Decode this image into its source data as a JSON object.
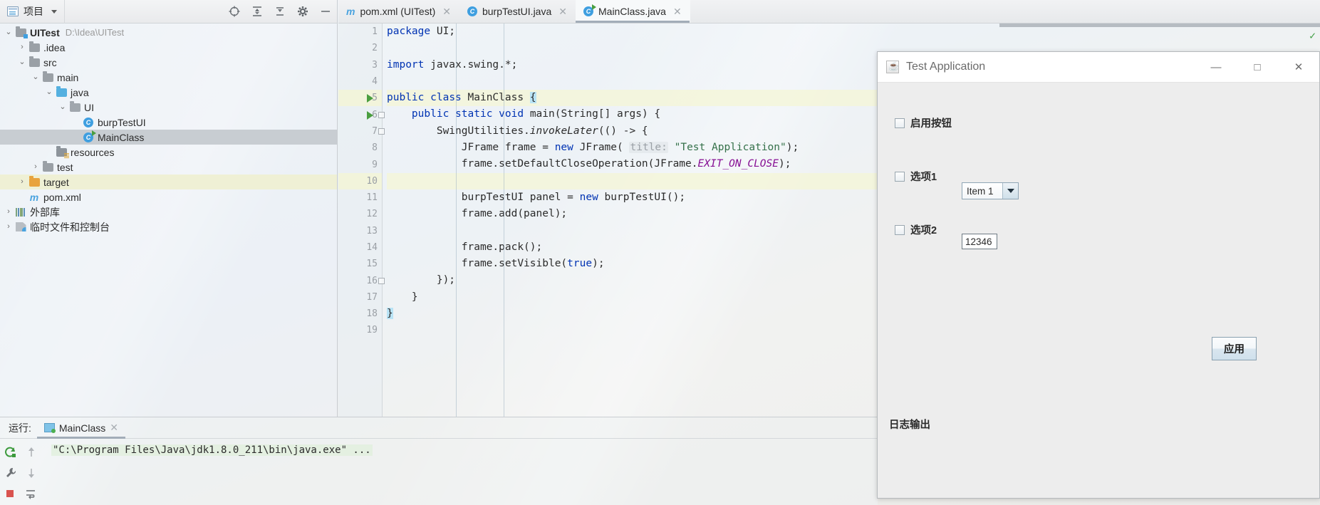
{
  "sidebar": {
    "title": "项目",
    "toolbar_icons": [
      "locate-icon",
      "expand-all-icon",
      "collapse-all-icon",
      "settings-gear-icon",
      "hide-icon"
    ],
    "tree": [
      {
        "label": "UITest",
        "note": "D:\\Idea\\UITest",
        "depth": 0,
        "arrow": "v",
        "icon": "project-folder-icon",
        "bold": true
      },
      {
        "label": ".idea",
        "note": "",
        "depth": 1,
        "arrow": ">",
        "icon": "folder-gray-icon",
        "bold": false
      },
      {
        "label": "src",
        "note": "",
        "depth": 1,
        "arrow": "v",
        "icon": "folder-gray-icon",
        "bold": false
      },
      {
        "label": "main",
        "note": "",
        "depth": 2,
        "arrow": "v",
        "icon": "folder-gray-icon",
        "bold": false
      },
      {
        "label": "java",
        "note": "",
        "depth": 3,
        "arrow": "v",
        "icon": "folder-source-icon",
        "bold": false
      },
      {
        "label": "UI",
        "note": "",
        "depth": 4,
        "arrow": "v",
        "icon": "package-icon",
        "bold": false
      },
      {
        "label": "burpTestUI",
        "note": "",
        "depth": 5,
        "arrow": "",
        "icon": "java-class-icon",
        "bold": false
      },
      {
        "label": "MainClass",
        "note": "",
        "depth": 5,
        "arrow": "",
        "icon": "java-class-runnable-icon",
        "bold": false,
        "selected": true
      },
      {
        "label": "resources",
        "note": "",
        "depth": 3,
        "arrow": "",
        "icon": "folder-resources-icon",
        "bold": false
      },
      {
        "label": "test",
        "note": "",
        "depth": 2,
        "arrow": ">",
        "icon": "folder-gray-icon",
        "bold": false
      },
      {
        "label": "target",
        "note": "",
        "depth": 1,
        "arrow": ">",
        "icon": "folder-orange-icon",
        "bold": false,
        "highlight": true
      },
      {
        "label": "pom.xml",
        "note": "",
        "depth": 1,
        "arrow": "",
        "icon": "maven-icon",
        "bold": false
      },
      {
        "label": "外部库",
        "note": "",
        "depth": 0,
        "arrow": ">",
        "icon": "external-libraries-icon",
        "bold": false
      },
      {
        "label": "临时文件和控制台",
        "note": "",
        "depth": 0,
        "arrow": ">",
        "icon": "scratches-icon",
        "bold": false
      }
    ]
  },
  "editor": {
    "tabs": [
      {
        "label": "pom.xml (UITest)",
        "icon": "maven-icon",
        "active": false
      },
      {
        "label": "burpTestUI.java",
        "icon": "java-class-icon",
        "active": false
      },
      {
        "label": "MainClass.java",
        "icon": "java-class-runnable-icon",
        "active": true
      }
    ],
    "close_glyph": "✕",
    "lines": [
      {
        "n": "1",
        "run": false,
        "fold": false,
        "hl": false
      },
      {
        "n": "2",
        "run": false,
        "fold": false,
        "hl": false
      },
      {
        "n": "3",
        "run": false,
        "fold": false,
        "hl": false
      },
      {
        "n": "4",
        "run": false,
        "fold": false,
        "hl": false
      },
      {
        "n": "5",
        "run": true,
        "fold": false,
        "hl": true
      },
      {
        "n": "6",
        "run": true,
        "fold": true,
        "hl": false
      },
      {
        "n": "7",
        "run": false,
        "fold": true,
        "hl": false
      },
      {
        "n": "8",
        "run": false,
        "fold": false,
        "hl": false
      },
      {
        "n": "9",
        "run": false,
        "fold": false,
        "hl": false
      },
      {
        "n": "10",
        "run": false,
        "fold": false,
        "hl": true
      },
      {
        "n": "11",
        "run": false,
        "fold": false,
        "hl": false
      },
      {
        "n": "12",
        "run": false,
        "fold": false,
        "hl": false
      },
      {
        "n": "13",
        "run": false,
        "fold": false,
        "hl": false
      },
      {
        "n": "14",
        "run": false,
        "fold": false,
        "hl": false
      },
      {
        "n": "15",
        "run": false,
        "fold": false,
        "hl": false
      },
      {
        "n": "16",
        "run": false,
        "fold": true,
        "hl": false
      },
      {
        "n": "17",
        "run": false,
        "fold": false,
        "hl": false
      },
      {
        "n": "18",
        "run": false,
        "fold": false,
        "hl": false
      },
      {
        "n": "19",
        "run": false,
        "fold": false,
        "hl": false
      }
    ],
    "code_text": [
      "package UI;",
      "",
      "import javax.swing.*;",
      "",
      "public class MainClass {",
      "    public static void main(String[] args) {",
      "        SwingUtilities.invokeLater(() -> {",
      "            JFrame frame = new JFrame( title: \"Test Application\");",
      "            frame.setDefaultCloseOperation(JFrame.EXIT_ON_CLOSE);",
      "",
      "            burpTestUI panel = new burpTestUI();",
      "            frame.add(panel);",
      "",
      "            frame.pack();",
      "            frame.setVisible(true);",
      "        });",
      "    }",
      "}",
      ""
    ]
  },
  "run_panel": {
    "label": "运行:",
    "tab_label": "MainClass",
    "close_glyph": "✕",
    "output": "\"C:\\Program Files\\Java\\jdk1.8.0_211\\bin\\java.exe\" ...",
    "side_icons": [
      "rerun-icon",
      "scroll-up-icon",
      "settings-wrench-icon",
      "scroll-down-icon",
      "stop-icon",
      "soft-wrap-icon"
    ]
  },
  "dialog": {
    "title": "Test Application",
    "app_icon": "java-coffee-icon",
    "window_buttons": {
      "minimize": "—",
      "maximize": "□",
      "close": "✕"
    },
    "checkbox_enable": "启用按钮",
    "checkbox_option1": "选项1",
    "checkbox_option2": "选项2",
    "combo_value": "Item 1",
    "text_value": "12346",
    "apply_button": "应用",
    "log_label": "日志输出"
  },
  "colors": {
    "accent": "#3f9fe0",
    "keyword": "#0033b3",
    "string": "#35714a",
    "static_field": "#871094",
    "highlight_line": "#f4f5d5",
    "selection": "#c8cdd2"
  }
}
